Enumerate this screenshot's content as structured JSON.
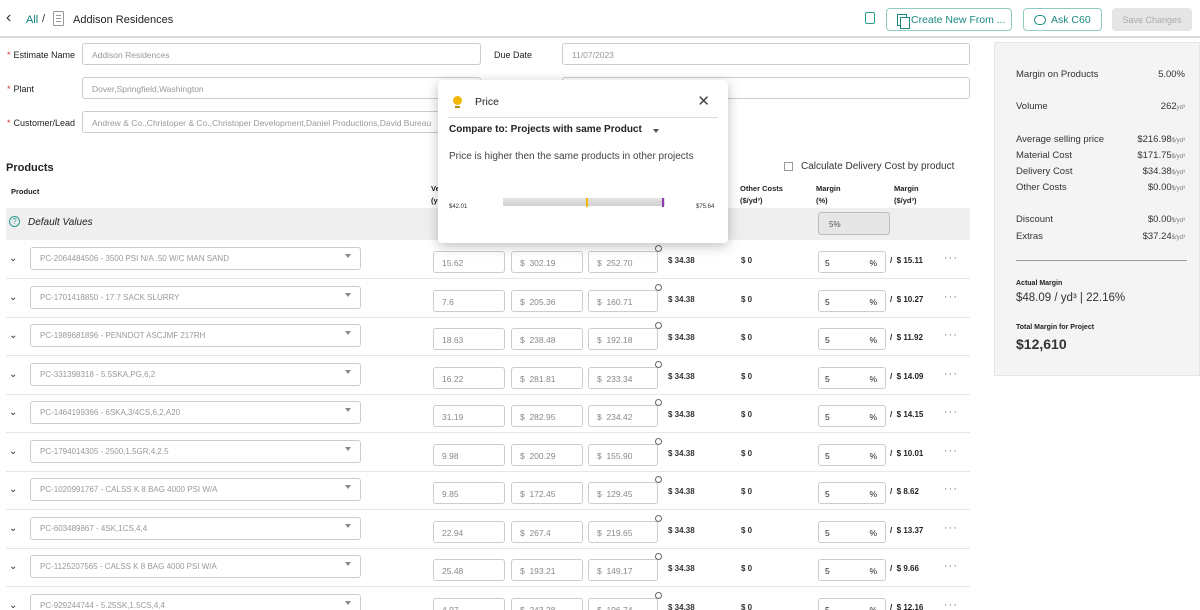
{
  "header": {
    "back_glyph": "‹",
    "crumb_all": "All",
    "crumb_sep": "/",
    "title": "Addison Residences",
    "create_label": "Create New From ...",
    "ask_label": "Ask C60",
    "save_label": "Save Changes"
  },
  "form": {
    "estimate_name_label": "Estimate Name",
    "estimate_name_value": "Addison Residences",
    "due_date_label": "Due Date",
    "due_date_value": "11/07/2023",
    "plant_label": "Plant",
    "plant_value": "Dover,Springfield,Washington",
    "customer_label": "Customer/Lead",
    "customer_value": "Andrew & Co.,Christoper & Co.,Christoper Development,Daniel Productions,David Bureau"
  },
  "products": {
    "title": "Products",
    "calc_delivery_label": "Calculate Delivery Cost by product",
    "headers": {
      "product": "Product",
      "volume_l1": "Ve",
      "volume_l2": "(y",
      "other_l1": "Other Costs",
      "other_l2": "($/yd³)",
      "margin_pct_l1": "Margin",
      "margin_pct_l2": "(%)",
      "margin_val_l1": "Margin",
      "margin_val_l2": "($/yd³)"
    },
    "default_label": "Default Values",
    "default_margin": "5%",
    "rows": [
      {
        "product": "PC-2064484506 - 3500 PSI N/A .50 W/C MAN SAND",
        "volume": "15.62",
        "c1": "302.19",
        "c2": "252.70",
        "delivery": "$ 34.38",
        "other": "$ 0",
        "margin_pct": "5",
        "margin_val": "$ 15.11"
      },
      {
        "product": "PC-1701418850 - 17.7 SACK SLURRY",
        "volume": "7.6",
        "c1": "205.36",
        "c2": "160.71",
        "delivery": "$ 34.38",
        "other": "$ 0",
        "margin_pct": "5",
        "margin_val": "$ 10.27"
      },
      {
        "product": "PC-1989681896 - PENNDOT ASCJMF 217RH",
        "volume": "18.63",
        "c1": "238.48",
        "c2": "192.18",
        "delivery": "$ 34.38",
        "other": "$ 0",
        "margin_pct": "5",
        "margin_val": "$ 11.92"
      },
      {
        "product": "PC-331398318 - 5.5SKA,PG,6,2",
        "volume": "16.22",
        "c1": "281.81",
        "c2": "233.34",
        "delivery": "$ 34.38",
        "other": "$ 0",
        "margin_pct": "5",
        "margin_val": "$ 14.09"
      },
      {
        "product": "PC-1464199366 - 6SKA,3/4CS,6,2,A20",
        "volume": "31.19",
        "c1": "282.95",
        "c2": "234.42",
        "delivery": "$ 34.38",
        "other": "$ 0",
        "margin_pct": "5",
        "margin_val": "$ 14.15"
      },
      {
        "product": "PC-1794014305 - 2500,1.5GR,4,2.5",
        "volume": "9.98",
        "c1": "200.29",
        "c2": "155.90",
        "delivery": "$ 34.38",
        "other": "$ 0",
        "margin_pct": "5",
        "margin_val": "$ 10.01"
      },
      {
        "product": "PC-1020991767 - CALSS K 8 BAG 4000 PSI W/A",
        "volume": "9.85",
        "c1": "172.45",
        "c2": "129.45",
        "delivery": "$ 34.38",
        "other": "$ 0",
        "margin_pct": "5",
        "margin_val": "$ 8.62"
      },
      {
        "product": "PC-603489867 - 4SK,1CS,4,4",
        "volume": "22.94",
        "c1": "267.4",
        "c2": "219.65",
        "delivery": "$ 34.38",
        "other": "$ 0",
        "margin_pct": "5",
        "margin_val": "$ 13.37"
      },
      {
        "product": "PC-1125207565 - CALSS K 8 BAG 4000 PSI W/A",
        "volume": "25.48",
        "c1": "193.21",
        "c2": "149.17",
        "delivery": "$ 34.38",
        "other": "$ 0",
        "margin_pct": "5",
        "margin_val": "$ 9.66"
      },
      {
        "product": "PC-929244744 - 5.25SK,1.5CS,4,4",
        "volume": "4.97",
        "c1": "243.28",
        "c2": "196.74",
        "delivery": "$ 34.38",
        "other": "$ 0",
        "margin_pct": "5",
        "margin_val": "$ 12.16"
      }
    ]
  },
  "summary": {
    "margin_on_products_label": "Margin on Products",
    "margin_on_products_value": "5.00%",
    "volume_label": "Volume",
    "volume_value": "262",
    "unit": "yd³",
    "unit_per": "$/yd³",
    "asp_label": "Average selling price",
    "asp_value": "$216.98",
    "material_label": "Material Cost",
    "material_value": "$171.75",
    "delivery_label": "Delivery Cost",
    "delivery_value": "$34.38",
    "other_label": "Other Costs",
    "other_value": "$0.00",
    "discount_label": "Discount",
    "discount_value": "$0.00",
    "extras_label": "Extras",
    "extras_value": "$37.24",
    "actual_margin_label": "Actual Margin",
    "actual_margin_value": "$48.09 / yd³ | 22.16%",
    "total_margin_label": "Total Margin for Project",
    "total_margin_value": "$12,610"
  },
  "popover": {
    "title": "Price",
    "close_glyph": "✕",
    "compare_label": "Compare to: Projects with same Product",
    "description": "Price is higher then the same products in other projects",
    "low": "$42.01",
    "high": "$75.64",
    "current_marker": 0.52,
    "max_marker": 0.99,
    "colors": {
      "current": "#f2b705",
      "max": "#8e3bb0"
    }
  },
  "colors": {
    "accent": "#1a8a80",
    "required": "#d33"
  },
  "icons": [
    "back-chevron-icon",
    "document-icon",
    "file-icon",
    "copy-icon",
    "brain-icon",
    "help-icon",
    "chevron-down-icon",
    "pin-icon",
    "more-icon",
    "bulb-icon",
    "close-icon",
    "caret-down-icon"
  ]
}
